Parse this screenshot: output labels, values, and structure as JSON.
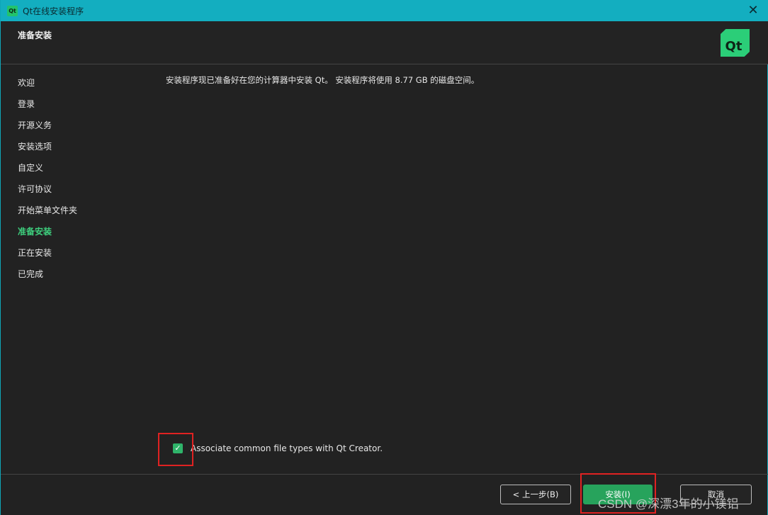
{
  "window": {
    "title": "Qt在线安装程序",
    "title_logo_text": "Qt",
    "close_glyph": "✕"
  },
  "header": {
    "page_title": "准备安装",
    "logo_text": "Qt"
  },
  "sidebar": {
    "items": [
      {
        "label": "欢迎"
      },
      {
        "label": "登录"
      },
      {
        "label": "开源义务"
      },
      {
        "label": "安装选项"
      },
      {
        "label": "自定义"
      },
      {
        "label": "许可协议"
      },
      {
        "label": "开始菜单文件夹"
      },
      {
        "label": "准备安装",
        "active": true
      },
      {
        "label": "正在安装"
      },
      {
        "label": "已完成"
      }
    ]
  },
  "main": {
    "message": "安装程序现已准备好在您的计算器中安装 Qt。 安装程序将使用 8.77 GB 的磁盘空间。",
    "checkbox_checked": true,
    "checkbox_glyph": "✓",
    "checkbox_label": "Associate common file types with Qt Creator."
  },
  "footer": {
    "back_label": "< 上一步(B)",
    "install_label": "安装(I)",
    "cancel_label": "取消"
  },
  "watermark": "CSDN @深漂3年的小镁铝",
  "colors": {
    "titlebar": "#13aec0",
    "accent": "#2bce78",
    "active_step": "#3ed07e",
    "annotation": "#e02222"
  },
  "icons": [
    "qt-logo-icon",
    "close-icon",
    "checkmark-icon"
  ]
}
